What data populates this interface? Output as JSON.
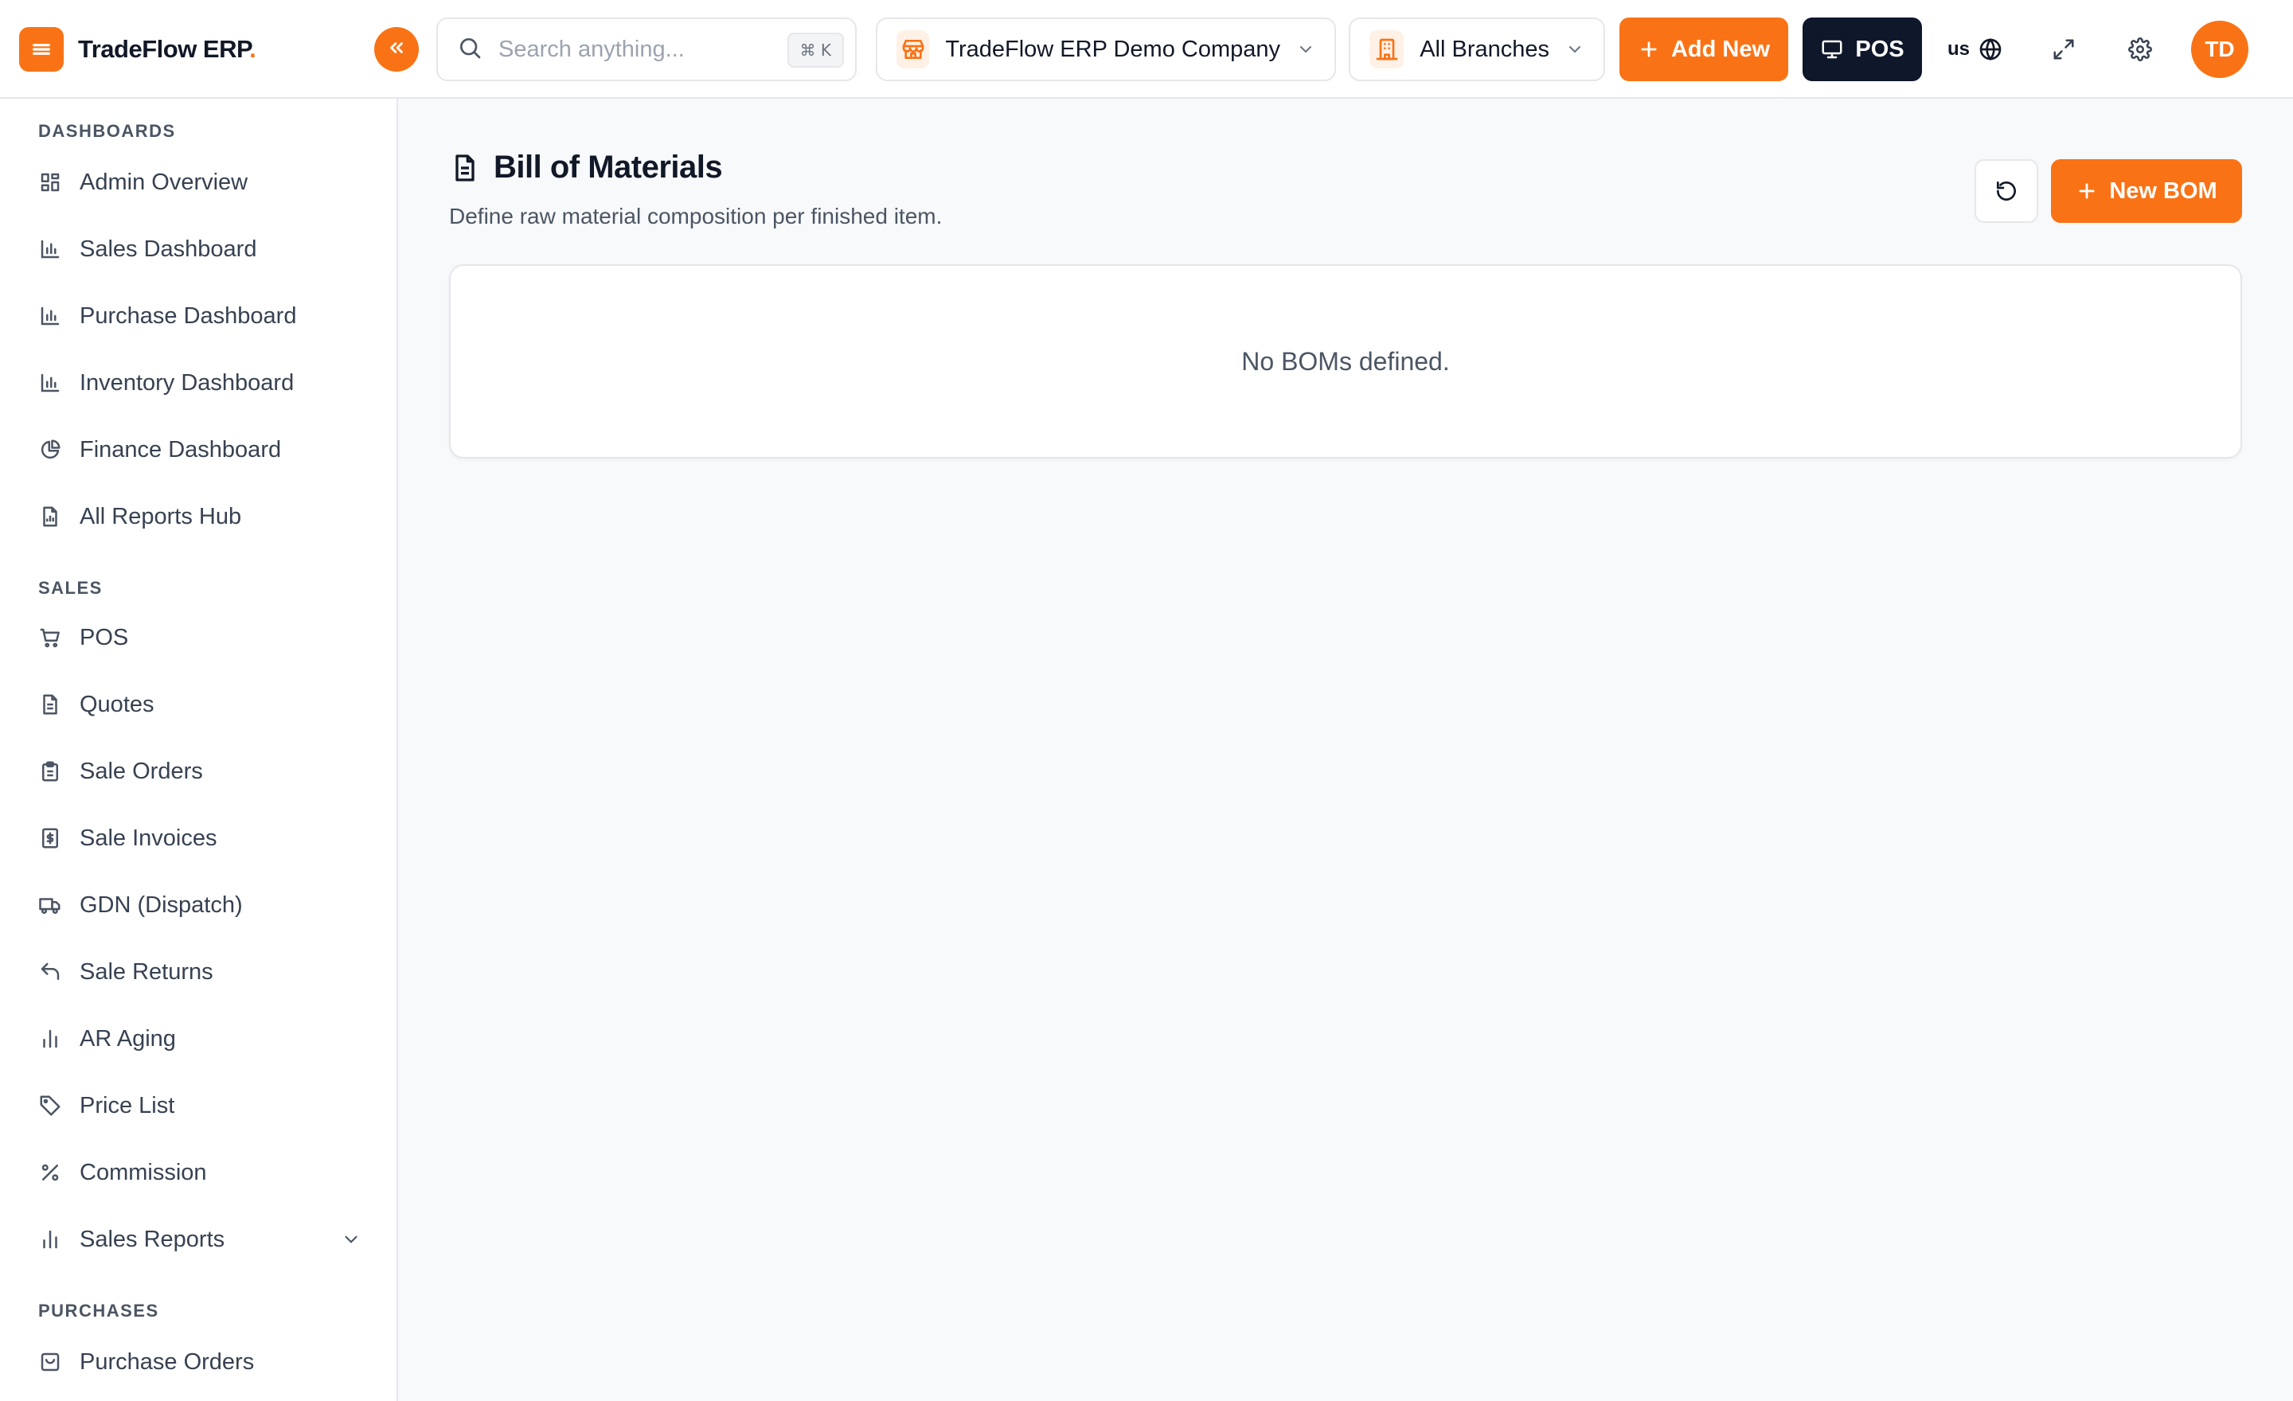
{
  "app": {
    "brand_name": "TradeFlow ERP",
    "brand_dot": "."
  },
  "colors": {
    "accent": "#f97316",
    "dark_button": "#0f172a",
    "text_primary": "#111827",
    "text_muted": "#4b5563"
  },
  "header": {
    "search_placeholder": "Search anything...",
    "search_shortcut": "⌘ K",
    "company_selector": "TradeFlow ERP Demo Company",
    "branch_selector": "All Branches",
    "add_new_label": "Add New",
    "pos_label": "POS",
    "language_code": "us",
    "avatar_initials": "TD",
    "icons": [
      "menu-icon",
      "double-chevron-left-icon",
      "search-icon",
      "store-icon",
      "building-icon",
      "chevron-down-icon",
      "plus-icon",
      "monitor-icon",
      "globe-icon",
      "expand-icon",
      "gear-icon"
    ]
  },
  "sidebar": {
    "sections": [
      {
        "label": "DASHBOARDS",
        "items": [
          {
            "label": "Admin Overview",
            "icon": "layout-grid-icon"
          },
          {
            "label": "Sales Dashboard",
            "icon": "bar-chart-icon"
          },
          {
            "label": "Purchase Dashboard",
            "icon": "bar-chart-icon"
          },
          {
            "label": "Inventory Dashboard",
            "icon": "bar-chart-icon"
          },
          {
            "label": "Finance Dashboard",
            "icon": "pie-chart-icon"
          },
          {
            "label": "All Reports Hub",
            "icon": "file-report-icon"
          }
        ]
      },
      {
        "label": "SALES",
        "items": [
          {
            "label": "POS",
            "icon": "cart-icon"
          },
          {
            "label": "Quotes",
            "icon": "file-text-icon"
          },
          {
            "label": "Sale Orders",
            "icon": "clipboard-icon"
          },
          {
            "label": "Sale Invoices",
            "icon": "dollar-file-icon"
          },
          {
            "label": "GDN (Dispatch)",
            "icon": "truck-icon"
          },
          {
            "label": "Sale Returns",
            "icon": "undo-icon"
          },
          {
            "label": "AR Aging",
            "icon": "bar-chart-simple-icon"
          },
          {
            "label": "Price List",
            "icon": "tag-icon"
          },
          {
            "label": "Commission",
            "icon": "percent-icon"
          },
          {
            "label": "Sales Reports",
            "icon": "bar-chart-simple-icon",
            "expandable": true
          }
        ]
      },
      {
        "label": "PURCHASES",
        "items": [
          {
            "label": "Purchase Orders",
            "icon": "shopping-bag-icon"
          }
        ]
      }
    ]
  },
  "main": {
    "title": "Bill of Materials",
    "subtitle": "Define raw material composition per finished item.",
    "new_button_label": "New BOM",
    "empty_message": "No BOMs defined."
  }
}
